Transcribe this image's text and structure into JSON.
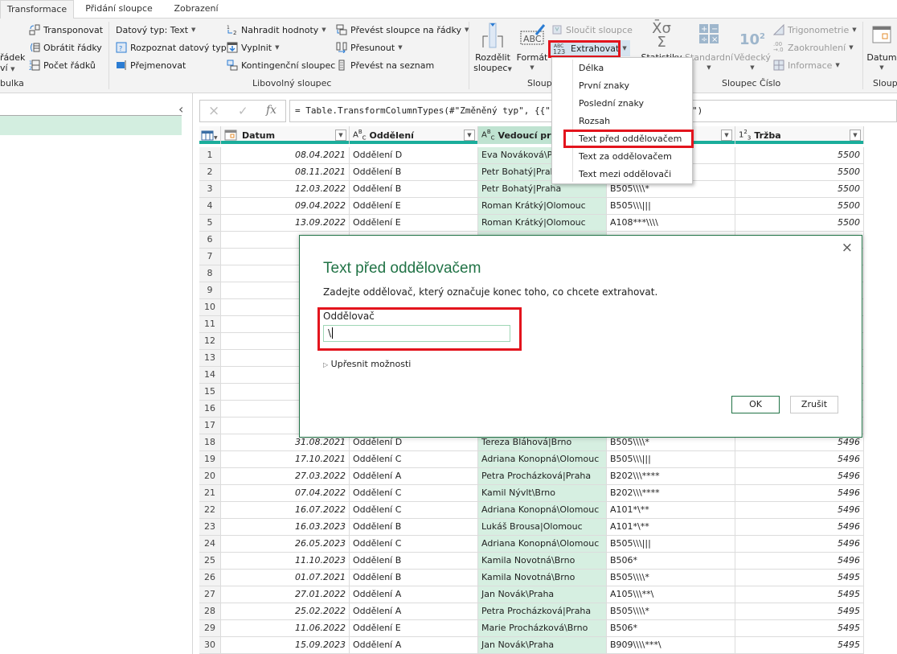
{
  "tabs": [
    {
      "label": "Transformace",
      "active": true
    },
    {
      "label": "Přidání sloupce",
      "active": false
    },
    {
      "label": "Zobrazení",
      "active": false
    }
  ],
  "ribbon": {
    "table_group": {
      "partial_label_line1": "řádek",
      "partial_label_line2": "ví",
      "transpose": "Transponovat",
      "reverse_rows": "Obrátit řádky",
      "count_rows": "Počet řádků",
      "group_label": "bulka"
    },
    "any_column_group": {
      "data_type": "Datový typ: Text",
      "detect_type": "Rozpoznat datový typ",
      "rename": "Přejmenovat",
      "replace_values": "Nahradit hodnoty",
      "fill": "Vyplnit",
      "pivot": "Kontingenční sloupec",
      "unpivot": "Převést sloupce na řádky",
      "move": "Přesunout",
      "to_list": "Převést na seznam",
      "group_label": "Libovolný sloupec"
    },
    "text_column_group": {
      "split_line1": "Rozdělit",
      "split_line2": "sloupec",
      "format": "Formát",
      "merge": "Sloučit sloupce",
      "extract": "Extrahovat",
      "group_label": "Sloup"
    },
    "number_column_group": {
      "statistics": "Statistiky",
      "standard": "Standardní",
      "scientific": "Vědecký",
      "trigonometry": "Trigonometrie",
      "rounding": "Zaokrouhlení",
      "information": "Informace",
      "group_label": "Sloupec Číslo"
    },
    "date_group": {
      "date": "Datum",
      "group_label": "Sloup"
    }
  },
  "extract_menu": {
    "items": [
      "Délka",
      "První znaky",
      "Poslední znaky",
      "Rozsah",
      "Text před oddělovačem",
      "Text za oddělovačem",
      "Text mezi oddělovači"
    ],
    "highlighted": "Text před oddělovačem"
  },
  "formula_bar": {
    "cancel_icon": "×",
    "confirm_icon": "✓",
    "fx_label": "fx",
    "formula_visible_start": "= Table.TransformColumnTypes(#\"Změněný typ\", {{\"",
    "formula_visible_end": "\")"
  },
  "table": {
    "columns": [
      {
        "name": "Datum",
        "type_icon": "date"
      },
      {
        "name": "Oddělení",
        "type_icon": "ABC"
      },
      {
        "name": "Vedoucí prac",
        "type_icon": "ABC",
        "selected": true
      },
      {
        "name": "",
        "type_icon": ""
      },
      {
        "name": "Tržba",
        "type_icon": "123"
      }
    ],
    "rows": [
      {
        "n": "1",
        "datum": "08.04.2021",
        "oddeleni": "Oddělení D",
        "vedouci": "Eva Nováková\\Praha",
        "kod": "",
        "trzba": "5500"
      },
      {
        "n": "2",
        "datum": "08.11.2021",
        "oddeleni": "Oddělení B",
        "vedouci": "Petr Bohatý|Praha",
        "kod": "",
        "trzba": "5500"
      },
      {
        "n": "3",
        "datum": "12.03.2022",
        "oddeleni": "Oddělení B",
        "vedouci": "Petr Bohatý|Praha",
        "kod": "B505\\\\\\\\*",
        "trzba": "5500"
      },
      {
        "n": "4",
        "datum": "09.04.2022",
        "oddeleni": "Oddělení E",
        "vedouci": "Roman Krátký|Olomouc",
        "kod": "B505\\\\\\|||",
        "trzba": "5500"
      },
      {
        "n": "5",
        "datum": "13.09.2022",
        "oddeleni": "Oddělení E",
        "vedouci": "Roman Krátký|Olomouc",
        "kod": "A108***\\\\\\\\",
        "trzba": "5500"
      },
      {
        "n": "6"
      },
      {
        "n": "7"
      },
      {
        "n": "8"
      },
      {
        "n": "9"
      },
      {
        "n": "10"
      },
      {
        "n": "11"
      },
      {
        "n": "12"
      },
      {
        "n": "13"
      },
      {
        "n": "14"
      },
      {
        "n": "15"
      },
      {
        "n": "16"
      },
      {
        "n": "17"
      },
      {
        "n": "18",
        "datum": "31.08.2021",
        "oddeleni": "Oddělení D",
        "vedouci": "Tereza Bláhová|Brno",
        "kod": "B505\\\\\\\\*",
        "trzba": "5496"
      },
      {
        "n": "19",
        "datum": "17.10.2021",
        "oddeleni": "Oddělení C",
        "vedouci": "Adriana Konopná\\Olomouc",
        "kod": "B505\\\\\\|||",
        "trzba": "5496"
      },
      {
        "n": "20",
        "datum": "27.03.2022",
        "oddeleni": "Oddělení A",
        "vedouci": "Petra Procházková|Praha",
        "kod": "B202\\\\\\****",
        "trzba": "5496"
      },
      {
        "n": "21",
        "datum": "07.04.2022",
        "oddeleni": "Oddělení C",
        "vedouci": "Kamil Nývlt\\Brno",
        "kod": "B202\\\\\\****",
        "trzba": "5496"
      },
      {
        "n": "22",
        "datum": "16.07.2022",
        "oddeleni": "Oddělení C",
        "vedouci": "Adriana Konopná\\Olomouc",
        "kod": "A101*\\**",
        "trzba": "5496"
      },
      {
        "n": "23",
        "datum": "16.03.2023",
        "oddeleni": "Oddělení B",
        "vedouci": "Lukáš Brousa|Olomouc",
        "kod": "A101*\\**",
        "trzba": "5496"
      },
      {
        "n": "24",
        "datum": "26.05.2023",
        "oddeleni": "Oddělení C",
        "vedouci": "Adriana Konopná\\Olomouc",
        "kod": "B505\\\\\\|||",
        "trzba": "5496"
      },
      {
        "n": "25",
        "datum": "11.10.2023",
        "oddeleni": "Oddělení B",
        "vedouci": "Kamila Novotná\\Brno",
        "kod": "B506*",
        "trzba": "5496"
      },
      {
        "n": "26",
        "datum": "01.07.2021",
        "oddeleni": "Oddělení B",
        "vedouci": "Kamila Novotná\\Brno",
        "kod": "B505\\\\\\\\*",
        "trzba": "5495"
      },
      {
        "n": "27",
        "datum": "27.01.2022",
        "oddeleni": "Oddělení A",
        "vedouci": "Jan Novák\\Praha",
        "kod": "A105\\\\\\**\\",
        "trzba": "5495"
      },
      {
        "n": "28",
        "datum": "25.02.2022",
        "oddeleni": "Oddělení A",
        "vedouci": "Petra Procházková|Praha",
        "kod": "B505\\\\\\\\*",
        "trzba": "5495"
      },
      {
        "n": "29",
        "datum": "11.06.2022",
        "oddeleni": "Oddělení E",
        "vedouci": "Marie Procházková\\Brno",
        "kod": "B506*",
        "trzba": "5495"
      },
      {
        "n": "30",
        "datum": "15.09.2023",
        "oddeleni": "Oddělení A",
        "vedouci": "Jan Novák\\Praha",
        "kod": "B909\\\\\\\\***\\",
        "trzba": "5495"
      }
    ]
  },
  "dialog": {
    "title": "Text před oddělovačem",
    "description": "Zadejte oddělovač, který označuje konec toho, co chcete extrahovat.",
    "delimiter_label": "Oddělovač",
    "delimiter_value": "\\",
    "advanced_options": "Upřesnit možnosti",
    "ok_label": "OK",
    "cancel_label": "Zrušit",
    "close_icon": "×"
  },
  "colors": {
    "accent_green": "#217346",
    "teal_header": "#1aad9b",
    "selected_column": "#d6efe1",
    "highlight_red": "#e3141d"
  }
}
